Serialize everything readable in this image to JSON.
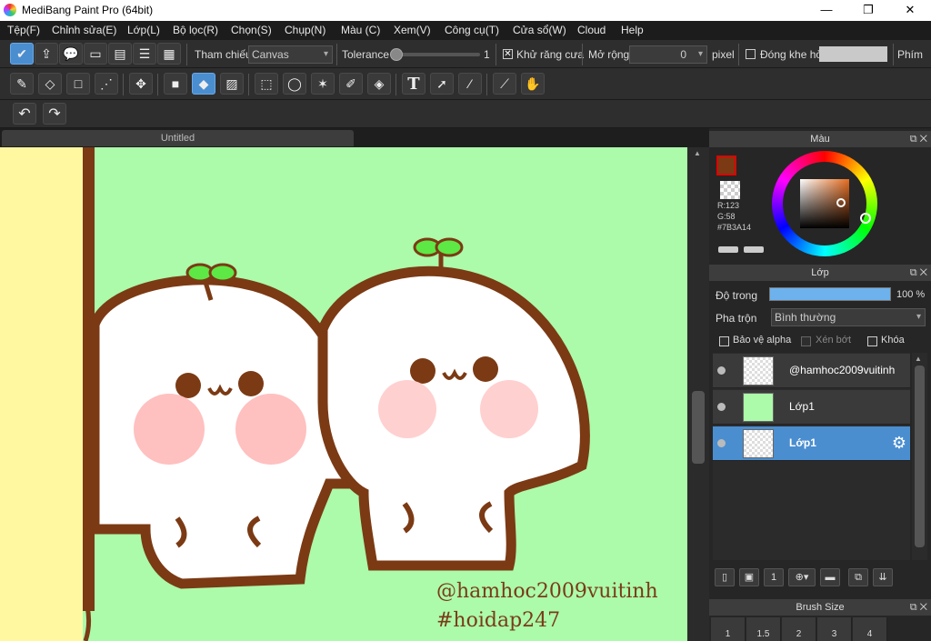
{
  "window": {
    "title": "MediBang Paint Pro (64bit)",
    "minimize": "—",
    "maximize": "❐",
    "close": "✕"
  },
  "menu": [
    "Tệp(F)",
    "Chỉnh sửa(E)",
    "Lớp(L)",
    "Bộ lọc(R)",
    "Chọn(S)",
    "Chụp(N)",
    "Màu (C)",
    "Xem(V)",
    "Công cụ(T)",
    "Cửa sổ(W)",
    "Cloud",
    "Help"
  ],
  "toolbar1": {
    "reference_label": "Tham chiếu",
    "reference_value": "Canvas",
    "tolerance_label": "Tolerance",
    "tolerance_value": "1",
    "antialias_label": "Khử răng cưa",
    "antialias_checked": "✕",
    "expand_label": "Mở rộng",
    "expand_value": "0",
    "expand_unit": "pixel",
    "close_gap_label": "Đóng khe hở",
    "shortcut_label": "Phím"
  },
  "document": {
    "tab_title": "Untitled"
  },
  "canvas": {
    "watermark_line1": "@hamhoc2009vuitinh",
    "watermark_line2": "#hoidap247"
  },
  "color_panel": {
    "title": "Màu",
    "r_label": "R:123",
    "g_label": "G:58",
    "hex_label": "#7B3A14",
    "primary_color": "#7B3A14",
    "secondary_color": "#f7e7c6"
  },
  "layer_panel": {
    "title": "Lớp",
    "opacity_label": "Độ trong",
    "opacity_value": "100 %",
    "opacity_fraction": 1.0,
    "blend_label": "Pha trộn",
    "blend_value": "Bình thường",
    "protect_alpha": "Bảo vệ alpha",
    "clipping": "Xén bớt",
    "lock": "Khóa",
    "layers": [
      {
        "name": "@hamhoc2009vuitinh",
        "selected": false
      },
      {
        "name": "Lớp1",
        "selected": false
      },
      {
        "name": "Lớp1",
        "selected": true
      }
    ]
  },
  "brush_panel": {
    "title": "Brush Size",
    "sizes": [
      "1",
      "1.5",
      "2",
      "3",
      "4"
    ]
  },
  "colors": {
    "canvas_bg": "#abfbaa",
    "accent": "#4a8ed0",
    "character_outline": "#7B3A14"
  }
}
